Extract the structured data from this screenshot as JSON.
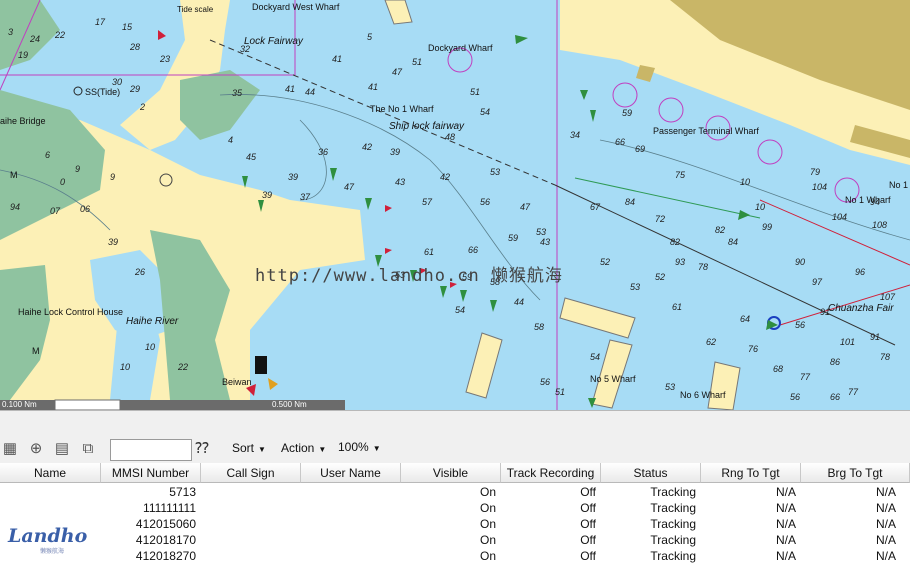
{
  "map": {
    "labels": {
      "dockyard_west_wharf": "Dockyard West Wharf",
      "lock_fairway": "Lock Fairway",
      "dockyard_wharf": "Dockyard Wharf",
      "ss_tide": "SS(Tide)",
      "the_no1_wharf": "The No 1 Wharf",
      "ship_lock_fairway": "Ship lock fairway",
      "passenger_terminal_wharf": "Passenger Terminal Wharf",
      "no1_wharf": "No 1 Wharf",
      "no1_right": "No 1",
      "haihe_bridge": "aihe Bridge",
      "haihe_lock_control_house": "Haihe Lock Control House",
      "haihe_river": "Haihe River",
      "beiwan": "Beiwan",
      "no5_wharf": "No 5 Wharf",
      "no6_wharf": "No 6 Wharf",
      "chuanzha_fair": "Chuanzha Fair",
      "m_left": "M",
      "m_mid": "M",
      "tide_scale": "Tide scale"
    },
    "watermark": "http://www.landho.cn 懒猴航海",
    "scale_left": "0.100 Nm",
    "scale_right": "0.500 Nm",
    "colors": {
      "water": "#a7dcf5",
      "land": "#fcf0b6",
      "green_land": "#8fc3a0",
      "magenta": "#c040c0",
      "contour": "#5a7f8c"
    }
  },
  "toolbar": {
    "search_placeholder": "",
    "sort_label": "Sort",
    "action_label": "Action",
    "zoom_label": "100%",
    "icons": [
      "grid-icon",
      "target-icon",
      "list-view-icon",
      "export-icon",
      "find-binoculars-icon"
    ]
  },
  "table": {
    "columns": [
      "Name",
      "MMSI Number",
      "Call Sign",
      "User Name",
      "Visible",
      "Track Recording",
      "Status",
      "Rng To Tgt",
      "Brg To Tgt"
    ],
    "rows": [
      {
        "name": "",
        "mmsi": "5713",
        "call": "",
        "user": "",
        "visible": "On",
        "track": "Off",
        "status": "Tracking",
        "rng": "N/A",
        "brg": "N/A"
      },
      {
        "name": "",
        "mmsi": "111111111",
        "call": "",
        "user": "",
        "visible": "On",
        "track": "Off",
        "status": "Tracking",
        "rng": "N/A",
        "brg": "N/A"
      },
      {
        "name": "",
        "mmsi": "412015060",
        "call": "",
        "user": "",
        "visible": "On",
        "track": "Off",
        "status": "Tracking",
        "rng": "N/A",
        "brg": "N/A"
      },
      {
        "name": "",
        "mmsi": "412018170",
        "call": "",
        "user": "",
        "visible": "On",
        "track": "Off",
        "status": "Tracking",
        "rng": "N/A",
        "brg": "N/A"
      },
      {
        "name": "",
        "mmsi": "412018270",
        "call": "",
        "user": "",
        "visible": "On",
        "track": "Off",
        "status": "Tracking",
        "rng": "N/A",
        "brg": "N/A"
      }
    ]
  },
  "logo": {
    "text": "Landho",
    "sub": "懒猴航海"
  }
}
